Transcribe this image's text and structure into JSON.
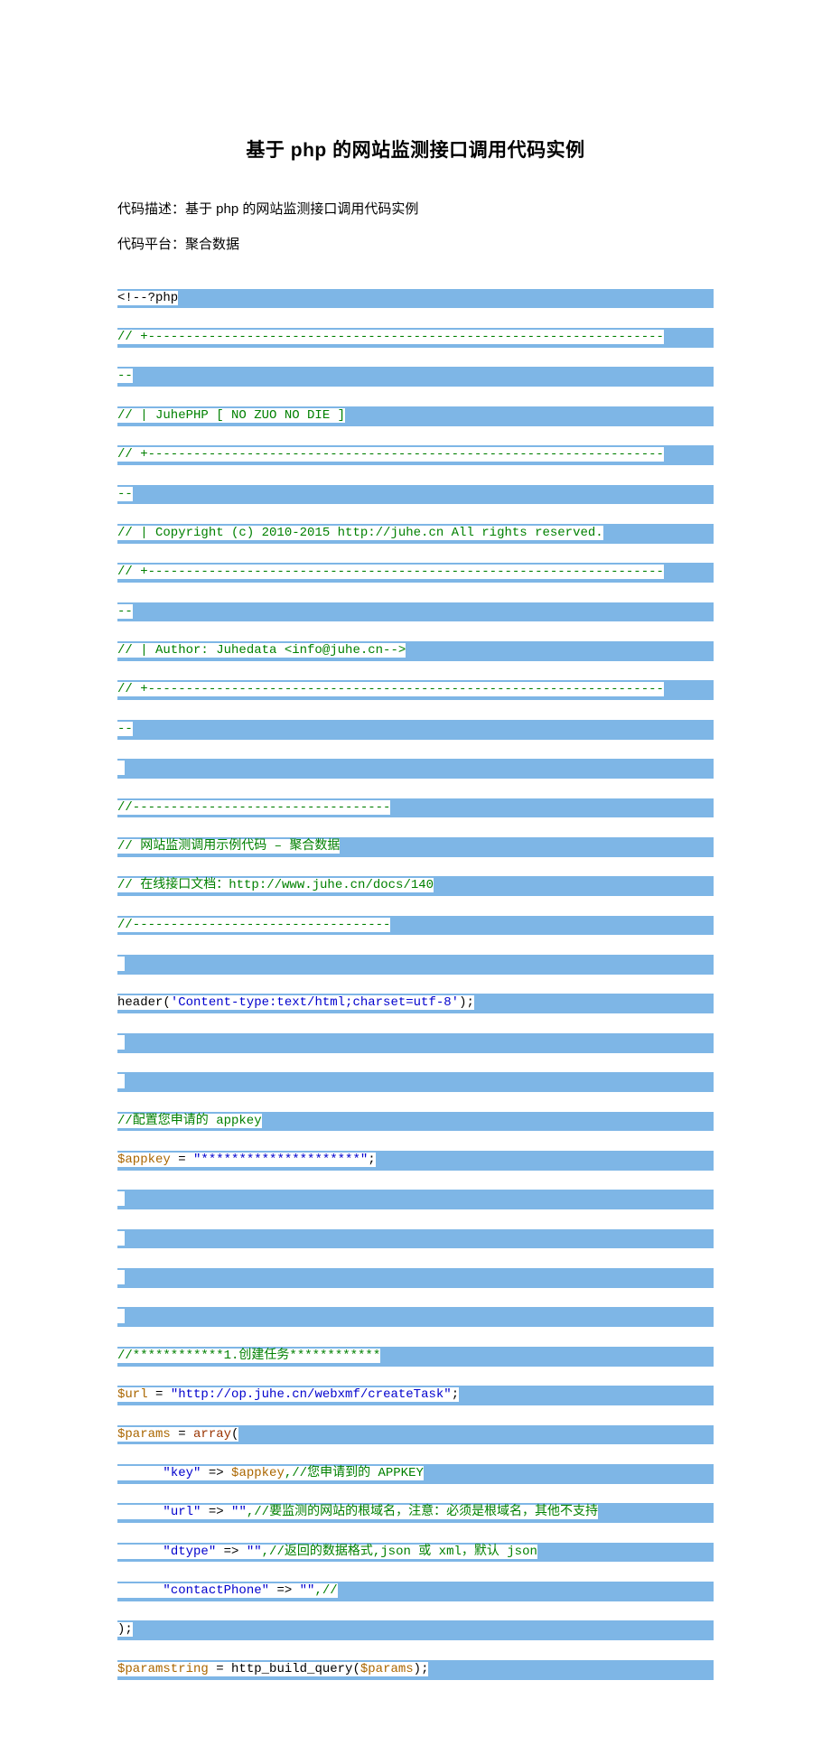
{
  "title": "基于 php 的网站监测接口调用代码实例",
  "desc_label": "代码描述：基于 php 的网站监测接口调用代码实例",
  "platform_label": "代码平台：聚合数据",
  "code": {
    "php_open": "<!--?php",
    "sep_top": "// +--------------------------------------------------------------------",
    "sep_cont": "--",
    "header_line": "// | JuhePHP [ NO ZUO NO DIE ]",
    "copyright": "// | Copyright (c) 2010-2015 http://juhe.cn All rights reserved.",
    "author": "// | Author: Juhedata <info@juhe.cn-->",
    "short_sep": "//----------------------------------",
    "sample_title": "// 网站监测调用示例代码 – 聚合数据",
    "docs_prefix": "// 在线接口文档：",
    "docs_url": "http://www.juhe.cn/docs/140",
    "header_call_pre": "header(",
    "header_call_str": "'Content-type:text/html;charset=utf-8'",
    "header_call_post": ");",
    "appkey_comment": "//配置您申请的 appkey",
    "appkey_var": "$appkey",
    "appkey_eq": " = ",
    "appkey_val": "\"*********************\"",
    "semicolon": ";",
    "section1_comment": "//************1.创建任务************",
    "url_var": "$url",
    "url_val": "\"http://op.juhe.cn/webxmf/createTask\"",
    "params_var": "$params",
    "array_kw": "array",
    "paren_open": "(",
    "k_key": "\"key\"",
    "arrow": " => ",
    "k_key_comment": ",//您申请到的 APPKEY",
    "k_url": "\"url\"",
    "empty_str": "\"\"",
    "k_url_comment": ",//要监测的网站的根域名，注意：必须是根域名，其他不支持",
    "k_dtype": "\"dtype\"",
    "k_dtype_comment": ",//返回的数据格式,json 或 xml，默认 json",
    "k_phone": "\"contactPhone\"",
    "k_phone_comment": ",//",
    "paren_close": ");",
    "pstring_var": "$paramstring",
    "build_query": " = http_build_query(",
    "build_query_close": ");",
    "indent": "      "
  }
}
